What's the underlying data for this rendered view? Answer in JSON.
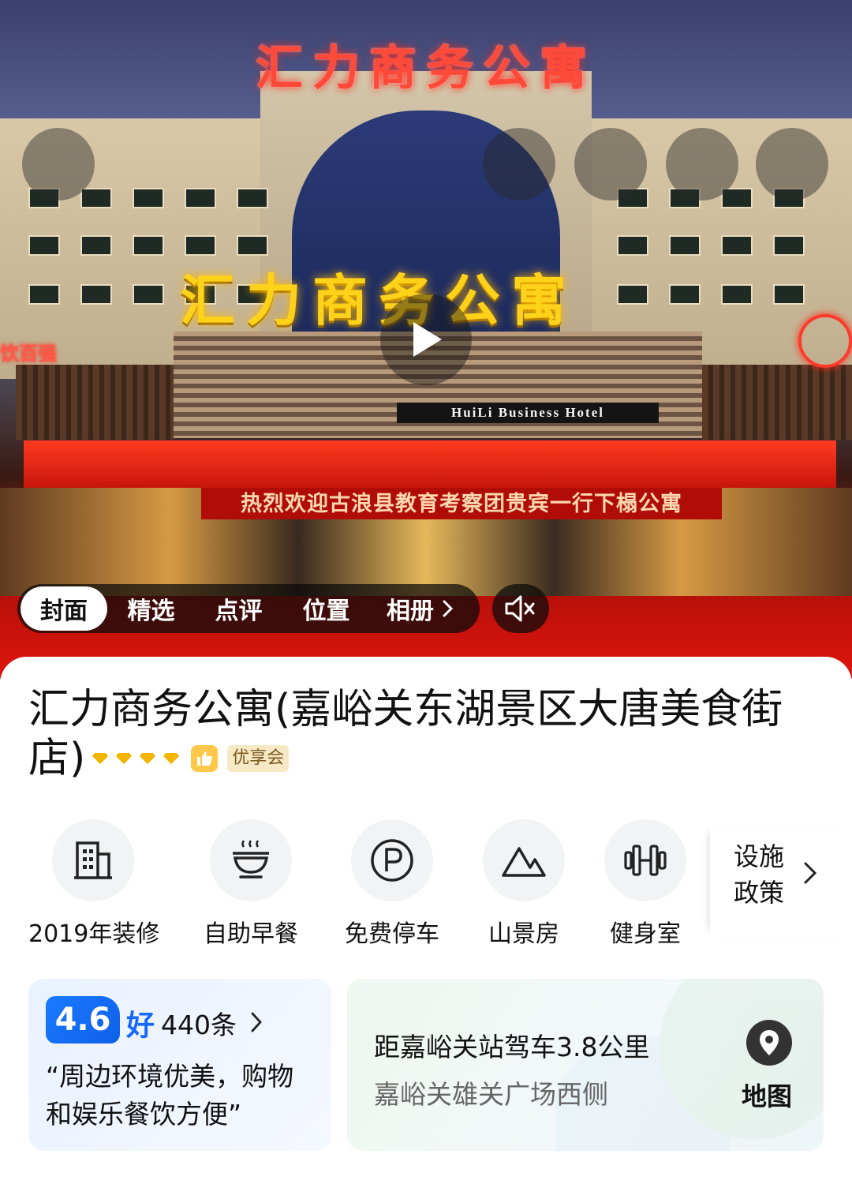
{
  "hero": {
    "neon_top_sign": "汇力商务公寓",
    "neon_main_sign": "汇力商务公寓",
    "hotel_plate": "HuiLi Business Hotel",
    "welcome_banner": "热烈欢迎古浪县教育考察团贵宾一行下榻公寓",
    "left_sign": "饮百强"
  },
  "tabs": {
    "items": [
      "封面",
      "精选",
      "点评",
      "位置",
      "相册"
    ],
    "active": "封面"
  },
  "hotel": {
    "name": "汇力商务公寓(嘉峪关东湖景区大唐美食街店)",
    "name_line1": "汇力商务公寓(嘉峪关东湖景区大唐美食街",
    "name_line2": "店)",
    "diamond_count": 4,
    "member_badge": "优享会",
    "colors": {
      "diamond": "#f5b400",
      "thumb_badge": "#ffc84a",
      "score_blue": "#1668ff"
    }
  },
  "facilities": [
    {
      "icon": "building-icon",
      "label": "2019年装修"
    },
    {
      "icon": "breakfast-icon",
      "label": "自助早餐"
    },
    {
      "icon": "parking-icon",
      "label": "免费停车"
    },
    {
      "icon": "mountain-icon",
      "label": "山景房"
    },
    {
      "icon": "dumbbell-icon",
      "label": "健身室"
    }
  ],
  "facilities_more": {
    "line1": "设施",
    "line2": "政策"
  },
  "review": {
    "score": "4.6",
    "rating_word": "好",
    "count": "440条",
    "quote_line1": "“周边环境优美，购物",
    "quote_line2": "和娱乐餐饮方便”"
  },
  "location": {
    "distance": "距嘉峪关站驾车3.8公里",
    "address": "嘉峪关雄关广场西侧",
    "map_label": "地图"
  }
}
